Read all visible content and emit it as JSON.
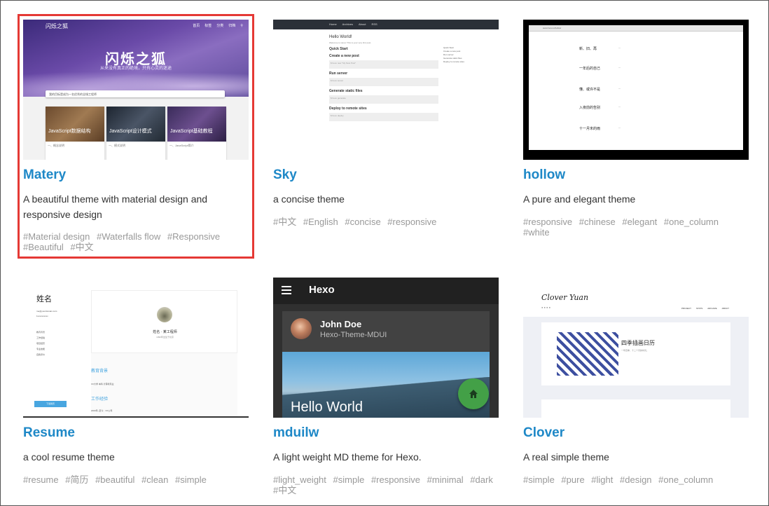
{
  "themes": [
    {
      "name": "Matery",
      "description": "A beautiful theme with material design and responsive design",
      "tags": [
        "#Material design",
        "#Waterfalls flow",
        "#Responsive",
        "#Beautiful",
        "#中文"
      ],
      "selected": true,
      "preview": {
        "logo": "闪烁之狐",
        "nav": [
          "首页",
          "标签",
          "分类",
          "归档"
        ],
        "heading": "闪烁之狐",
        "subheading": "从来没有真正的绝境，只有心灵的迷途",
        "notice": "我的目标是成为一名优秀的全栈工程师",
        "cards": [
          {
            "caption": "JavaScript数据结构",
            "text": "一、概念说明"
          },
          {
            "caption": "JavaScript设计模式",
            "text": "一、模式说明"
          },
          {
            "caption": "JavaScript基础教程",
            "text": "一、JavaScript简介"
          }
        ]
      }
    },
    {
      "name": "Sky",
      "description": "a concise theme",
      "tags": [
        "#中文",
        "#English",
        "#concise",
        "#responsive"
      ],
      "selected": false,
      "preview": {
        "nav": [
          "Home",
          "Archives",
          "About",
          "RSS"
        ],
        "heading": "Hello World!",
        "intro": "Welcome to Hexo! This is your very first post.",
        "sections": [
          "Quick Start",
          "Create a new post",
          "Run server",
          "Generate static files",
          "Deploy to remote sites"
        ],
        "codes": [
          "$ hexo new \"My New Post\"",
          "$ hexo server",
          "$ hexo generate",
          "$ hexo deploy"
        ],
        "sidebar": [
          "Quick Start",
          "Create a new post",
          "Run server",
          "Generate static files",
          "Deploy to remote sites"
        ]
      }
    },
    {
      "name": "hollow",
      "description": "A pure and elegant theme",
      "tags": [
        "#responsive",
        "#chinese",
        "#elegant",
        "#one_column",
        "#white"
      ],
      "selected": false,
      "preview": {
        "url": "www.hexo.io/hollow",
        "rows": [
          "新、旧、再",
          "一年后的自己",
          "懂、或许不是",
          "入夜前的告别",
          "十一月末的雨"
        ]
      }
    },
    {
      "name": "Resume",
      "description": "a cool resume theme",
      "tags": [
        "#resume",
        "#简历",
        "#beautiful",
        "#clean",
        "#simple"
      ],
      "selected": false,
      "preview": {
        "name": "姓名",
        "contact": [
          "me@yourdomain.com",
          "1xxxxxxxxxx"
        ],
        "sidebar": [
          "教育背景",
          "工作经验",
          "项目经历",
          "专业技能",
          "自我评价"
        ],
        "button": "下载简历",
        "card_name": "姓名 · 某工程师",
        "card_text": "1990年出生于北京",
        "sections": [
          "教育背景",
          "工作经验"
        ],
        "education": "XX大学 本科 计算机专业",
        "work": "2000年~至今：XX公司"
      }
    },
    {
      "name": "mduilw",
      "description": "A light weight MD theme for Hexo.",
      "tags": [
        "#light_weight",
        "#simple",
        "#responsive",
        "#minimal",
        "#dark",
        "#中文"
      ],
      "selected": false,
      "preview": {
        "app_title": "Hexo",
        "author": "John Doe",
        "subtitle": "Hexo-Theme-MDUI",
        "post_title": "Hello World"
      }
    },
    {
      "name": "Clover",
      "description": "A real simple theme",
      "tags": [
        "#simple",
        "#pure",
        "#light",
        "#design",
        "#one_column"
      ],
      "selected": false,
      "preview": {
        "logo": "Clover Yuan",
        "nav": [
          "PROJECT",
          "STATS",
          "ARCHIVE",
          "ABOUT"
        ],
        "post_title": "四季插画日历",
        "post_text": "一年四季，十二个月的时光。"
      }
    }
  ],
  "colors": {
    "title": "#1e88c7",
    "tag": "#999999",
    "selection_border": "#e53935"
  }
}
